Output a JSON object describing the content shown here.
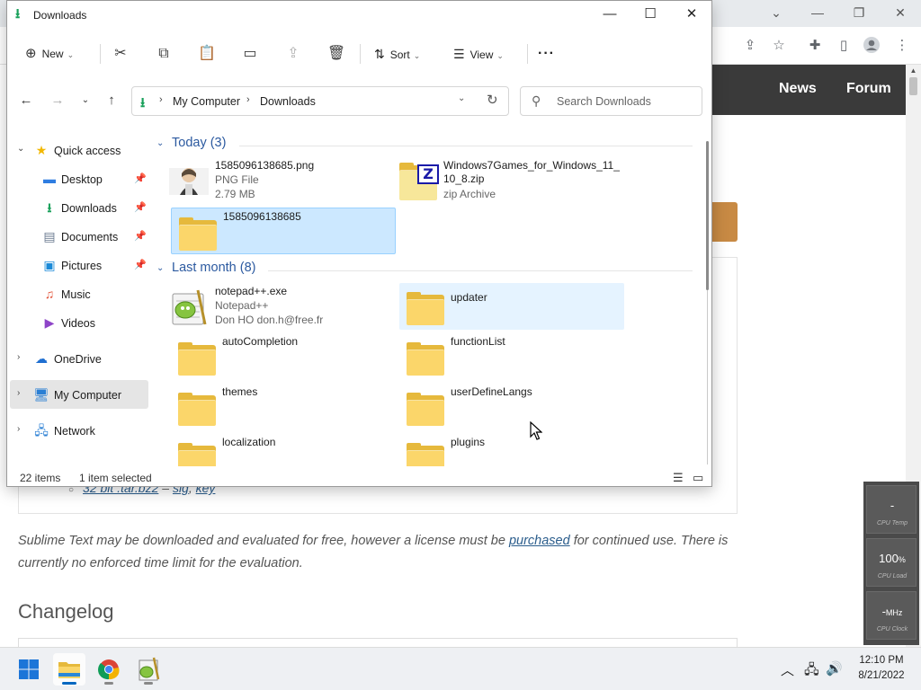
{
  "explorer": {
    "title": "Downloads",
    "window_controls": {
      "minimize": "—",
      "maximize": "☐",
      "close": "✕"
    },
    "command_bar": {
      "new_label": "New",
      "sort_label": "Sort",
      "view_label": "View",
      "more_label": "···"
    },
    "address": {
      "crumbs": [
        "My Computer",
        "Downloads"
      ]
    },
    "search": {
      "placeholder": "Search Downloads"
    },
    "nav_pane": {
      "items": [
        {
          "label": "Quick access",
          "icon": "star-icon"
        },
        {
          "label": "Desktop",
          "icon": "desktop-icon",
          "pinned": true
        },
        {
          "label": "Downloads",
          "icon": "downloads-icon",
          "pinned": true
        },
        {
          "label": "Documents",
          "icon": "documents-icon",
          "pinned": true
        },
        {
          "label": "Pictures",
          "icon": "pictures-icon",
          "pinned": true
        },
        {
          "label": "Music",
          "icon": "music-icon"
        },
        {
          "label": "Videos",
          "icon": "videos-icon"
        },
        {
          "label": "OneDrive",
          "icon": "cloud-icon"
        },
        {
          "label": "My Computer",
          "icon": "computer-icon",
          "selected": true
        },
        {
          "label": "Network",
          "icon": "network-icon"
        }
      ]
    },
    "groups": [
      {
        "label": "Today (3)"
      },
      {
        "label": "Last month (8)"
      }
    ],
    "files": [
      {
        "name": "1585096138685.png",
        "type": "PNG File",
        "size": "2.79 MB",
        "icon": "image-thumbnail"
      },
      {
        "name": "Windows7Games_for_Windows_11_",
        "name2": "10_8.zip",
        "type": "zip Archive",
        "icon": "zip-folder-icon"
      },
      {
        "name": "1585096138685",
        "icon": "folder-icon",
        "selected": true
      },
      {
        "name": "notepad++.exe",
        "type": "Notepad++",
        "author": "Don HO don.h@free.fr",
        "icon": "notepadpp-icon"
      },
      {
        "name": "updater",
        "icon": "folder-icon",
        "hovered": true
      },
      {
        "name": "autoCompletion",
        "icon": "folder-icon"
      },
      {
        "name": "functionList",
        "icon": "folder-icon"
      },
      {
        "name": "themes",
        "icon": "folder-icon"
      },
      {
        "name": "userDefineLangs",
        "icon": "folder-icon"
      },
      {
        "name": "localization",
        "icon": "folder-icon"
      },
      {
        "name": "plugins",
        "icon": "folder-icon"
      }
    ],
    "status": {
      "items_count": "22 items",
      "selected_count": "1 item selected"
    }
  },
  "website": {
    "nav_links": [
      "News",
      "Forum"
    ],
    "download_link": {
      "text": "32 bit .tar.bz2",
      "dash": " – ",
      "sig": "sig",
      "comma": ", ",
      "key": "key"
    },
    "license_text_1": "Sublime Text may be downloaded and evaluated for free, however a license must be ",
    "license_link": "purchased",
    "license_text_2": " for continued use. There is currently no enforced time limit for the evaluation.",
    "changelog_heading": "Changelog"
  },
  "cpu_widget": {
    "temp_value": "-",
    "temp_label": "CPU Temp",
    "load_value": "100",
    "load_unit": "%",
    "load_label": "CPU Load",
    "clock_value": "-",
    "clock_unit": "MHz",
    "clock_label": "CPU Clock"
  },
  "taskbar": {
    "apps": [
      "start-icon",
      "file-explorer-icon",
      "chrome-icon",
      "notepadpp-icon"
    ],
    "time": "12:10 PM",
    "date": "8/21/2022"
  },
  "colors": {
    "accent": "#0067c0",
    "group_header": "#2c5aa0",
    "selection": "#cce8ff",
    "folder": "#fbd66a",
    "site_nav": "#3a3a3a",
    "link": "#2b5d8c"
  }
}
